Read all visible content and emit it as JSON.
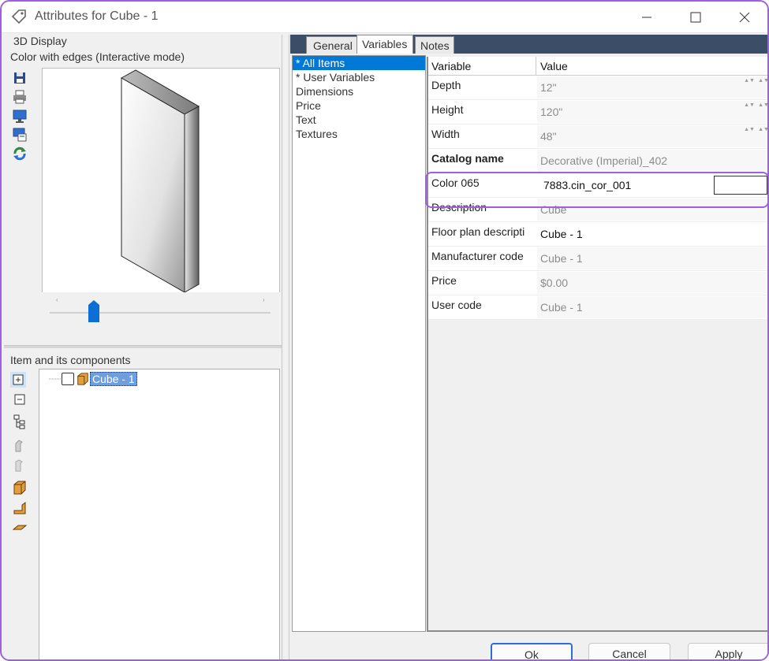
{
  "window": {
    "title": "Attributes for Cube - 1",
    "controls": {
      "minimize": "minimize-icon",
      "maximize": "maximize-icon",
      "close": "close-icon"
    }
  },
  "display": {
    "group_label": "3D Display",
    "mode_label": "Color with edges (Interactive mode)",
    "toolbar": [
      "save-icon",
      "print-icon",
      "monitor-icon",
      "screen-copy-icon",
      "refresh-icon"
    ],
    "slider_level": 0.2
  },
  "components": {
    "group_label": "Item and its components",
    "toolbar": [
      "expand-all-icon",
      "collapse-all-icon",
      "tree-structure-icon",
      "tool-disabled-icon",
      "tool-disabled-2-icon",
      "cube-3d-icon",
      "corner-piece-icon",
      "flat-piece-icon"
    ],
    "tree": [
      {
        "label": "Cube - 1",
        "checked": false,
        "selected": true
      }
    ]
  },
  "tabs": [
    {
      "label": "General",
      "active": false
    },
    {
      "label": "Variables",
      "active": true
    },
    {
      "label": "Notes",
      "active": false
    }
  ],
  "categories": [
    "* All Items",
    "* User Variables",
    "Dimensions",
    "Price",
    "Text",
    "Textures"
  ],
  "grid": {
    "headers": {
      "variable": "Variable",
      "value": "Value"
    },
    "rows": [
      {
        "name": "Depth",
        "value": "12\"",
        "spinner": true,
        "editable": false
      },
      {
        "name": "Height",
        "value": "120\"",
        "spinner": true,
        "editable": false
      },
      {
        "name": "Width",
        "value": "48\"",
        "spinner": true,
        "editable": false
      },
      {
        "name": "Catalog name",
        "value": "Decorative (Imperial)_402",
        "bold": true,
        "editable": false
      },
      {
        "name": "Color 065",
        "value": "7883.cin_cor_001",
        "editable": true,
        "highlighted": true
      },
      {
        "name": "Description",
        "value": "Cube",
        "editable": false
      },
      {
        "name": "Floor plan descripti",
        "value": "Cube - 1",
        "editable": true
      },
      {
        "name": "Manufacturer code",
        "value": "Cube - 1",
        "editable": false
      },
      {
        "name": "Price",
        "value": "$0.00",
        "editable": false
      },
      {
        "name": "User code",
        "value": "Cube - 1",
        "editable": false
      }
    ]
  },
  "buttons": {
    "ok": "Ok",
    "cancel": "Cancel",
    "apply": "Apply"
  },
  "colors": {
    "accent": "#a05fe0",
    "selection": "#0078d7",
    "tabstrip": "#3c4d67"
  }
}
